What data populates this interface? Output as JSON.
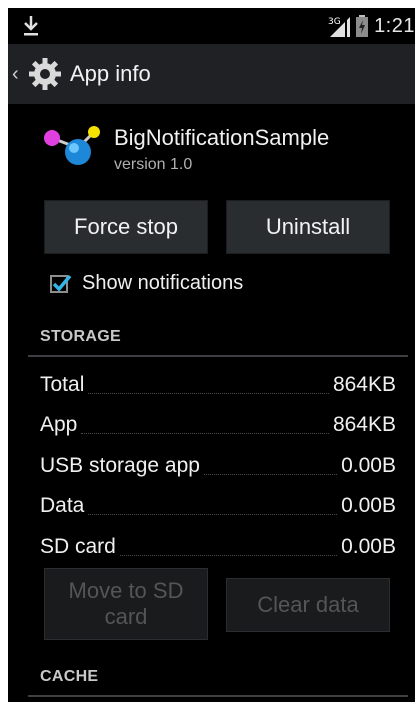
{
  "status_bar": {
    "clock": "1:21",
    "network_label": "3G",
    "icons": [
      "download-icon",
      "signal-icon",
      "battery-icon"
    ]
  },
  "action_bar": {
    "title": "App info",
    "icon": "gear-icon"
  },
  "app": {
    "name": "BigNotificationSample",
    "version": "version 1.0",
    "icon": "molecule-app-icon"
  },
  "buttons": {
    "force_stop": "Force stop",
    "uninstall": "Uninstall",
    "move_to_sd": "Move to SD card",
    "clear_data": "Clear data"
  },
  "notifications": {
    "label": "Show notifications",
    "checked": true
  },
  "storage": {
    "header": "STORAGE",
    "rows": [
      {
        "label": "Total",
        "value": "864KB"
      },
      {
        "label": "App",
        "value": "864KB"
      },
      {
        "label": "USB storage app",
        "value": "0.00B"
      },
      {
        "label": "Data",
        "value": "0.00B"
      },
      {
        "label": "SD card",
        "value": "0.00B"
      }
    ]
  },
  "cache": {
    "header": "CACHE"
  },
  "colors": {
    "background": "#000000",
    "action_bar": "#1f2124",
    "accent": "#33b5e5",
    "button": "#2a2d30"
  }
}
